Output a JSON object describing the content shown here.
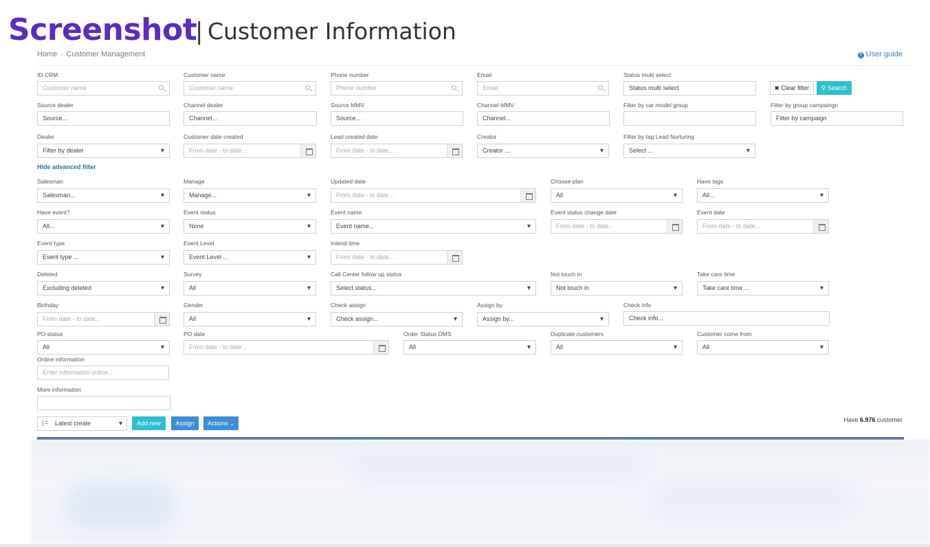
{
  "header": {
    "brand": "Screenshot",
    "separator": "|",
    "title": "Customer Information"
  },
  "breadcrumb": {
    "home": "Home",
    "arrow": "›",
    "current": "Customer Management"
  },
  "user_guide": {
    "icon": "question-circle-icon",
    "label": "User guide"
  },
  "filters": {
    "id_crm": {
      "label": "ID CRM",
      "placeholder": "Customer name"
    },
    "customer_name": {
      "label": "Customer name",
      "placeholder": "Customer name"
    },
    "phone_number": {
      "label": "Phone number",
      "placeholder": "Phone number"
    },
    "email": {
      "label": "Email",
      "placeholder": "Email"
    },
    "status_multi": {
      "label": "Status multi select",
      "value": "Status multi select"
    },
    "clear_filter": "Clear filter",
    "search": "Search",
    "source_dealer": {
      "label": "Source dealer",
      "value": "Source..."
    },
    "channel_dealer": {
      "label": "Channel dealer",
      "value": "Channel..."
    },
    "source_mmv": {
      "label": "Source MMV",
      "value": "Source..."
    },
    "channel_mmv": {
      "label": "Channel MMV",
      "value": "Channel..."
    },
    "car_model_group": {
      "label": "Filter by car model group",
      "value": ""
    },
    "group_campaign": {
      "label": "Filter by group campaingn",
      "value": "Filter by campaign"
    },
    "dealer": {
      "label": "Dealer",
      "value": "Filter by dealer"
    },
    "customer_date_created": {
      "label": "Customer date created",
      "placeholder": "From date - to date..."
    },
    "lead_created_date": {
      "label": "Lead created date",
      "placeholder": "From date - to date..."
    },
    "creator": {
      "label": "Creator",
      "value": "Creator ..."
    },
    "tag_lead_nurturing": {
      "label": "Filter by tag Lead Nurturing",
      "value": "Select ..."
    }
  },
  "hide_advanced": "Hide advanced filter",
  "advanced": {
    "salesman": {
      "label": "Salesman",
      "value": "Salesman..."
    },
    "manage": {
      "label": "Manage",
      "value": "Manage..."
    },
    "updated_date": {
      "label": "Updated date",
      "placeholder": "From date - to date..."
    },
    "choose_plan": {
      "label": "Choose plan",
      "value": "All"
    },
    "have_tags": {
      "label": "Have tags",
      "value": "All..."
    },
    "have_event": {
      "label": "Have event?",
      "value": "All..."
    },
    "event_status": {
      "label": "Event status",
      "value": "None"
    },
    "event_name": {
      "label": "Event name",
      "value": "Event name..."
    },
    "event_status_change_date": {
      "label": "Event status change date",
      "placeholder": "From date - to date..."
    },
    "event_date": {
      "label": "Event date",
      "placeholder": "From date - to date..."
    },
    "event_type": {
      "label": "Event type",
      "value": "Event type ..."
    },
    "event_level": {
      "label": "Event Level",
      "value": "Event Level ..."
    },
    "intend_time": {
      "label": "Intend time",
      "placeholder": "From date - to date..."
    },
    "deleted": {
      "label": "Deleted",
      "value": "Excluding deleted"
    },
    "survey": {
      "label": "Survey",
      "value": "All"
    },
    "call_center": {
      "label": "Call Center follow up status",
      "value": "Select status..."
    },
    "not_touch_in": {
      "label": "Not touch in",
      "value": "Not touch in"
    },
    "take_care_time": {
      "label": "Take care time",
      "value": "Take care time ..."
    },
    "birthday": {
      "label": "Birthday",
      "placeholder": "From date - to date..."
    },
    "gender": {
      "label": "Gender",
      "value": "All"
    },
    "check_assign": {
      "label": "Check assign",
      "value": "Check assign..."
    },
    "assign_by": {
      "label": "Assign by",
      "value": "Assign by..."
    },
    "check_info": {
      "label": "Check info",
      "value": "Check info..."
    },
    "po_status": {
      "label": "PO status",
      "value": "All"
    },
    "po_date": {
      "label": "PO date",
      "placeholder": "From date - to date..."
    },
    "order_status_dms": {
      "label": "Order Status DMS",
      "value": "All"
    },
    "duplicate_customers": {
      "label": "Duplicate customers",
      "value": "All"
    },
    "customer_come_from": {
      "label": "Customer come from",
      "value": "All"
    },
    "online_information": {
      "label": "Online information",
      "placeholder": "Enter information online..."
    },
    "more_information": {
      "label": "More information",
      "value": ""
    }
  },
  "toolbar": {
    "sort": "Latest create",
    "add_new": "Add new",
    "assign": "Assign",
    "actions": "Actions",
    "have_prefix": "Have",
    "count": "6.976",
    "have_suffix": "customer"
  },
  "colors": {
    "brand": "#5b2bc4",
    "accent": "#2bbfd3",
    "primary": "#3a8fd8",
    "table_header": "#3d5f9e"
  }
}
